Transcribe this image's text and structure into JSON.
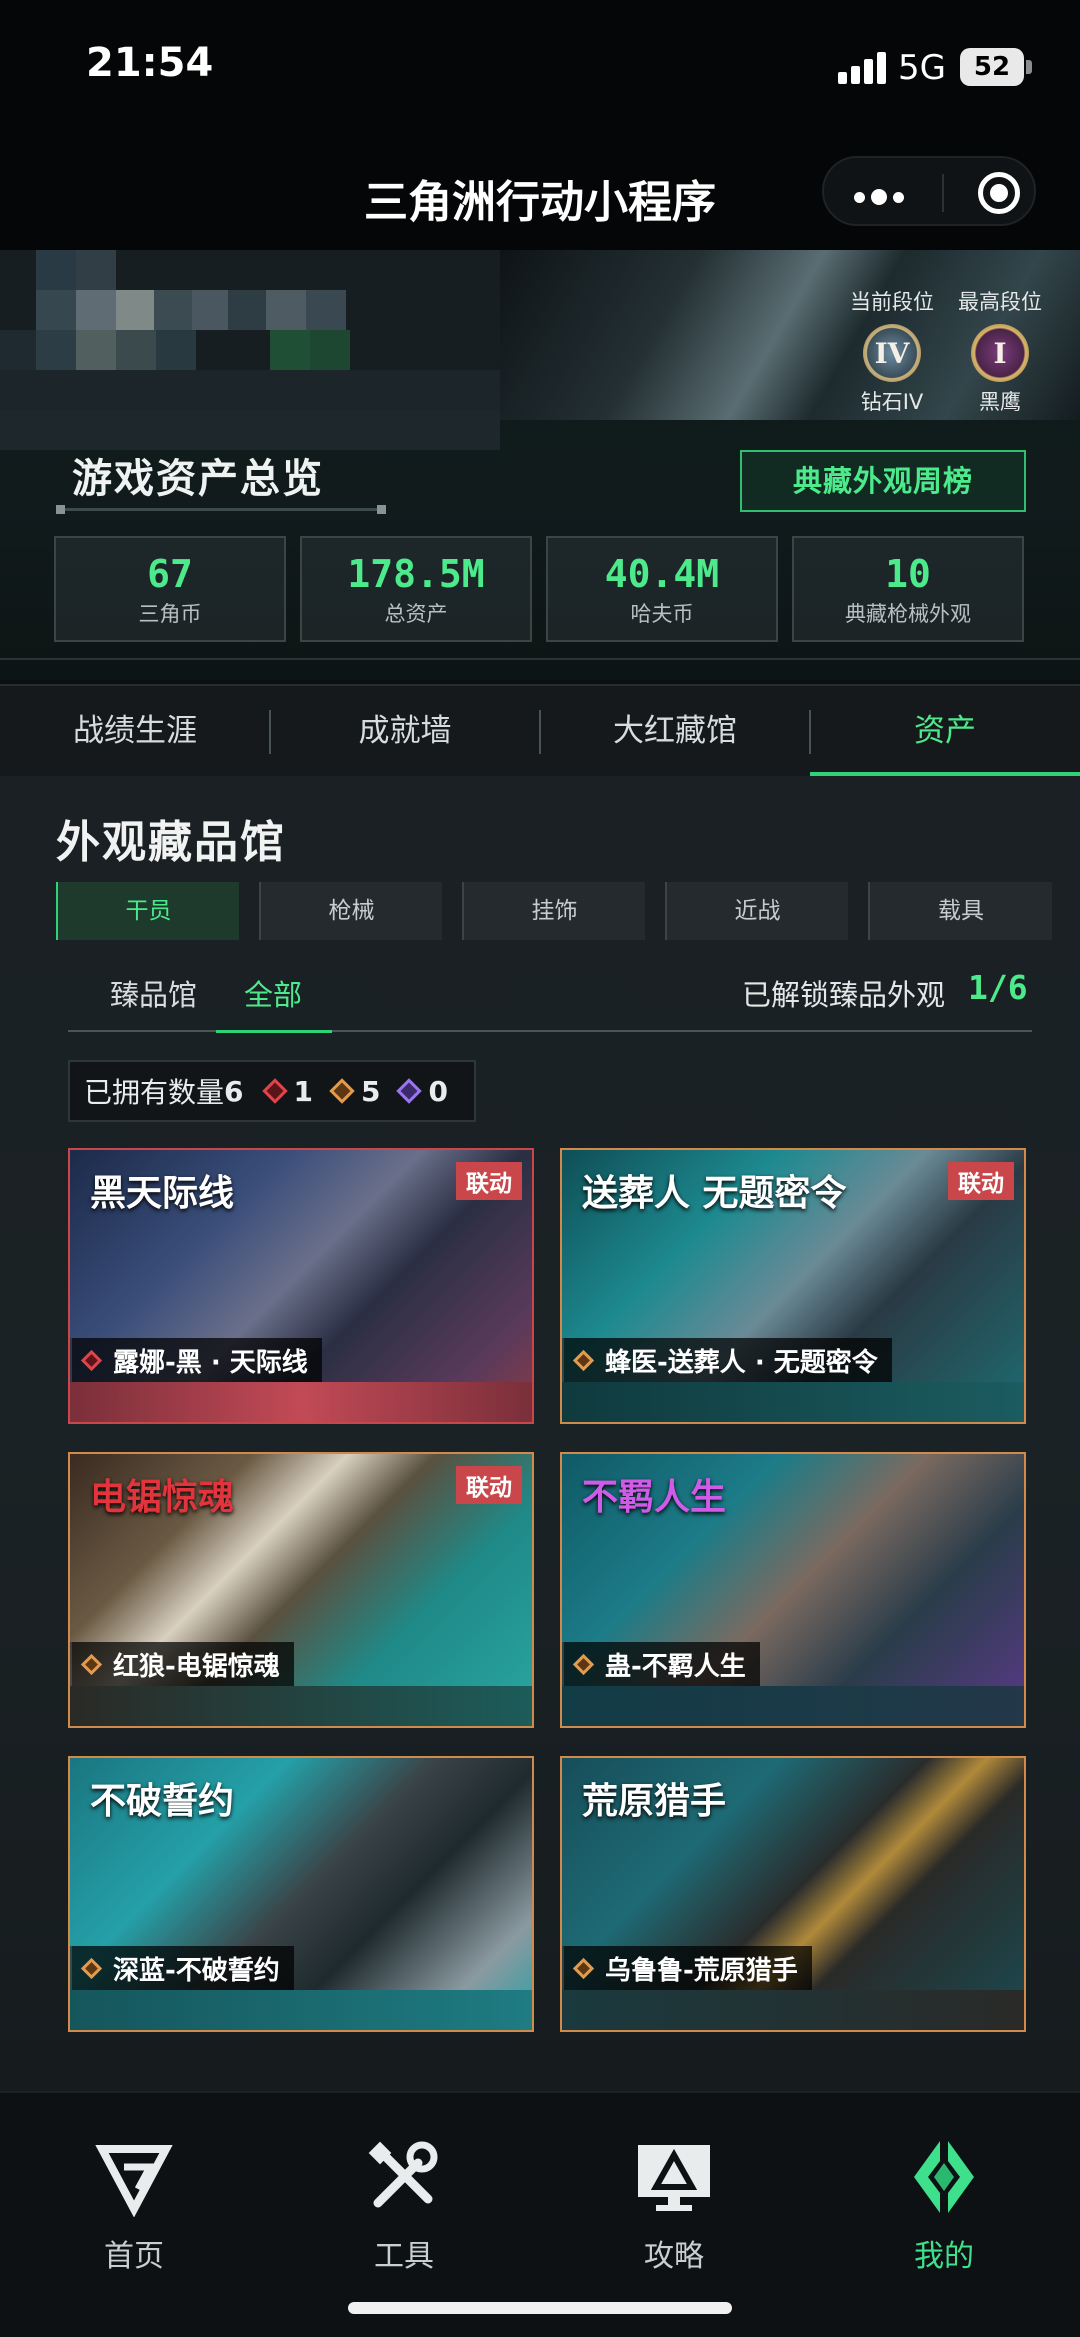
{
  "status_bar": {
    "time": "21:54",
    "network": "5G",
    "battery": "52"
  },
  "header": {
    "title": "三角洲行动小程序"
  },
  "rank": {
    "current_label": "当前段位",
    "current_tier": "IV",
    "current_name": "钻石IV",
    "highest_label": "最高段位",
    "highest_tier": "I",
    "highest_name": "黑鹰"
  },
  "overview": {
    "title": "游戏资产总览",
    "weekly_button": "典藏外观周榜",
    "stats": [
      {
        "value": "67",
        "label": "三角币"
      },
      {
        "value": "178.5M",
        "label": "总资产"
      },
      {
        "value": "40.4M",
        "label": "哈夫币"
      },
      {
        "value": "10",
        "label": "典藏枪械外观"
      }
    ]
  },
  "tabs": [
    {
      "label": "战绩生涯"
    },
    {
      "label": "成就墙"
    },
    {
      "label": "大红藏馆"
    },
    {
      "label": "资产",
      "active": true
    }
  ],
  "gallery": {
    "title": "外观藏品馆",
    "categories": [
      {
        "label": "干员",
        "active": true
      },
      {
        "label": "枪械"
      },
      {
        "label": "挂饰"
      },
      {
        "label": "近战"
      },
      {
        "label": "载具"
      }
    ],
    "sub_tabs": [
      {
        "label": "臻品馆"
      },
      {
        "label": "全部",
        "active": true
      }
    ],
    "unlock_label": "已解锁臻品外观",
    "unlock_value": "1/6",
    "owned": {
      "label": "已拥有数量",
      "total": "6",
      "red": "1",
      "gold": "5",
      "purple": "0"
    },
    "items": [
      {
        "name": "露娜-黑 · 天际线",
        "rarity": "red",
        "collab": "联动",
        "logo": "黑天际线"
      },
      {
        "name": "蜂医-送葬人 · 无题密令",
        "rarity": "gold",
        "collab": "联动",
        "logo": "送葬人 无题密令"
      },
      {
        "name": "红狼-电锯惊魂",
        "rarity": "gold",
        "collab": "联动",
        "logo": "电锯惊魂"
      },
      {
        "name": "蛊-不羁人生",
        "rarity": "gold",
        "collab": "",
        "logo": "不羁人生"
      },
      {
        "name": "深蓝-不破誓约",
        "rarity": "gold",
        "collab": "",
        "logo": "不破誓约"
      },
      {
        "name": "乌鲁鲁-荒原猎手",
        "rarity": "gold",
        "collab": "",
        "logo": "荒原猎手"
      }
    ]
  },
  "bottom_nav": [
    {
      "label": "首页",
      "icon": "home-logo-icon"
    },
    {
      "label": "工具",
      "icon": "tools-icon"
    },
    {
      "label": "攻略",
      "icon": "guide-monitor-icon"
    },
    {
      "label": "我的",
      "icon": "profile-logo-icon",
      "active": true
    }
  ],
  "colors": {
    "accent": "#4dea8c",
    "red_rarity": "#c9464b",
    "gold_rarity": "#d08a4c"
  }
}
